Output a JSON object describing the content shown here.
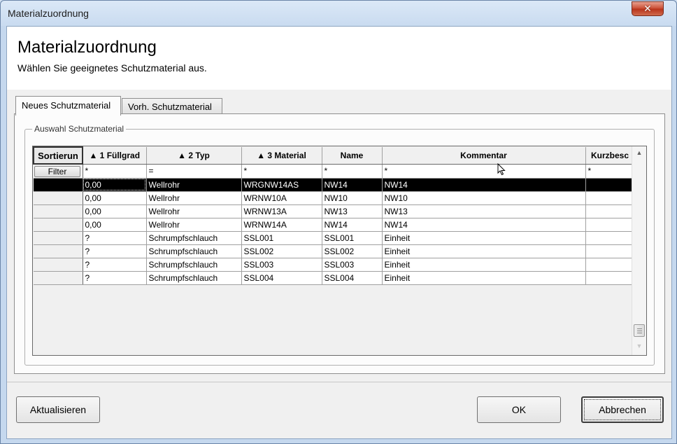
{
  "window": {
    "title": "Materialzuordnung",
    "close_symbol": "✕"
  },
  "header": {
    "title": "Materialzuordnung",
    "subtitle": "Wählen Sie geeignetes Schutzmaterial aus."
  },
  "tabs": [
    {
      "label": "Neues Schutzmaterial",
      "active": true
    },
    {
      "label": "Vorh. Schutzmaterial",
      "active": false
    }
  ],
  "group": {
    "label": "Auswahl Schutzmaterial"
  },
  "grid": {
    "corner_label": "Sortierun",
    "filter_button": "Filter",
    "columns": [
      "▲ 1 Füllgrad",
      "▲ 2 Typ",
      "▲ 3 Material",
      "Name",
      "Kommentar",
      "Kurzbesc"
    ],
    "filters": [
      "*",
      "=",
      "*",
      "*",
      "*",
      "*"
    ],
    "rows": [
      [
        "0,00",
        "Wellrohr",
        "WRGNW14AS",
        "NW14",
        "NW14",
        ""
      ],
      [
        "0,00",
        "Wellrohr",
        "WRNW10A",
        "NW10",
        "NW10",
        ""
      ],
      [
        "0,00",
        "Wellrohr",
        "WRNW13A",
        "NW13",
        "NW13",
        ""
      ],
      [
        "0,00",
        "Wellrohr",
        "WRNW14A",
        "NW14",
        "NW14",
        ""
      ],
      [
        "?",
        "Schrumpfschlauch",
        "SSL001",
        "SSL001",
        "Einheit",
        ""
      ],
      [
        "?",
        "Schrumpfschlauch",
        "SSL002",
        "SSL002",
        "Einheit",
        ""
      ],
      [
        "?",
        "Schrumpfschlauch",
        "SSL003",
        "SSL003",
        "Einheit",
        ""
      ],
      [
        "?",
        "Schrumpfschlauch",
        "SSL004",
        "SSL004",
        "Einheit",
        ""
      ]
    ],
    "selected_row": 0,
    "scroll_up": "▲",
    "scroll_down": "▼"
  },
  "buttons": {
    "refresh": "Aktualisieren",
    "ok": "OK",
    "cancel": "Abbrechen"
  }
}
